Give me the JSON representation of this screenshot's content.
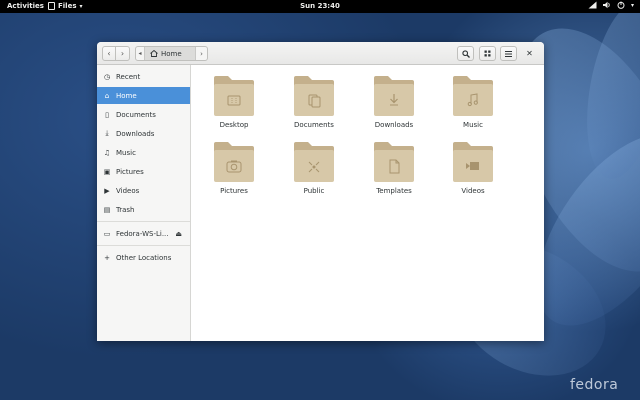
{
  "topbar": {
    "activities": "Activities",
    "app_name": "Files",
    "clock": "Sun 23:40"
  },
  "headerbar": {
    "path_current": "Home"
  },
  "sidebar": {
    "items": [
      {
        "label": "Recent",
        "icon": "clock-icon"
      },
      {
        "label": "Home",
        "icon": "home-icon"
      },
      {
        "label": "Documents",
        "icon": "document-icon"
      },
      {
        "label": "Downloads",
        "icon": "download-icon"
      },
      {
        "label": "Music",
        "icon": "music-icon"
      },
      {
        "label": "Pictures",
        "icon": "pictures-icon"
      },
      {
        "label": "Videos",
        "icon": "video-icon"
      },
      {
        "label": "Trash",
        "icon": "trash-icon"
      },
      {
        "label": "Fedora-WS-Li...",
        "icon": "drive-icon"
      },
      {
        "label": "Other Locations",
        "icon": "plus-icon"
      }
    ]
  },
  "folders": [
    {
      "label": "Desktop",
      "emblem": "desktop-emblem-icon"
    },
    {
      "label": "Documents",
      "emblem": "documents-emblem-icon"
    },
    {
      "label": "Downloads",
      "emblem": "downloads-emblem-icon"
    },
    {
      "label": "Music",
      "emblem": "music-emblem-icon"
    },
    {
      "label": "Pictures",
      "emblem": "camera-emblem-icon"
    },
    {
      "label": "Public",
      "emblem": "share-emblem-icon"
    },
    {
      "label": "Templates",
      "emblem": "template-emblem-icon"
    },
    {
      "label": "Videos",
      "emblem": "video-emblem-icon"
    }
  ],
  "colors": {
    "selection": "#4a90d9",
    "folder_body": "#d7c8a8",
    "folder_tab": "#c4b08c",
    "folder_emblem": "#a8946e"
  },
  "wallpaper_logo": "fedora"
}
